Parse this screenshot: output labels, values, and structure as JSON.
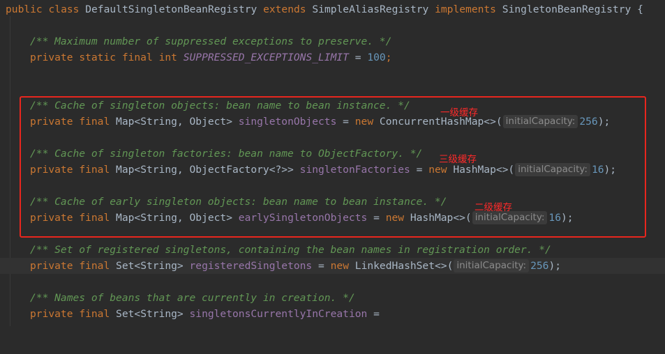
{
  "code": {
    "class_decl": {
      "kw_public": "public",
      "kw_class": "class",
      "class_name": "DefaultSingletonBeanRegistry",
      "kw_extends": "extends",
      "super_name": "SimpleAliasRegistry",
      "kw_implements": "implements",
      "iface_name": "SingletonBeanRegistry",
      "brace": "{"
    },
    "suppressed": {
      "comment": "/** Maximum number of suppressed exceptions to preserve. */",
      "kw_private": "private",
      "kw_static": "static",
      "kw_final": "final",
      "kw_int": "int",
      "const_name": "SUPPRESSED_EXCEPTIONS_LIMIT",
      "assign": "=",
      "value": "100",
      "semi": ";"
    },
    "singleton_objects": {
      "comment": "/** Cache of singleton objects: bean name to bean instance. */",
      "kw_private": "private",
      "kw_final": "final",
      "type": "Map<String, Object>",
      "field": "singletonObjects",
      "assign": "=",
      "kw_new": "new",
      "ctor": "ConcurrentHashMap<>(",
      "hint": "initialCapacity:",
      "arg": "256",
      "close": ");"
    },
    "singleton_factories": {
      "comment": "/** Cache of singleton factories: bean name to ObjectFactory. */",
      "kw_private": "private",
      "kw_final": "final",
      "type": "Map<String, ObjectFactory<?>>",
      "field": "singletonFactories",
      "assign": "=",
      "kw_new": "new",
      "ctor": "HashMap<>(",
      "hint": "initialCapacity:",
      "arg": "16",
      "close": ");"
    },
    "early_singleton_objects": {
      "comment": "/** Cache of early singleton objects: bean name to bean instance. */",
      "kw_private": "private",
      "kw_final": "final",
      "type": "Map<String, Object>",
      "field": "earlySingletonObjects",
      "assign": "=",
      "kw_new": "new",
      "ctor": "HashMap<>(",
      "hint": "initialCapacity:",
      "arg": "16",
      "close": ");"
    },
    "registered_singletons": {
      "comment": "/** Set of registered singletons, containing the bean names in registration order. */",
      "kw_private": "private",
      "kw_final": "final",
      "type": "Set<String>",
      "field": "registeredSingletons",
      "assign": "=",
      "kw_new": "new",
      "ctor": "LinkedHashSet<>(",
      "hint": "initialCapacity:",
      "arg": "256",
      "close": ");"
    },
    "currently_in_creation": {
      "comment": "/** Names of beans that are currently in creation. */",
      "kw_private": "private",
      "kw_final": "final",
      "type": "Set<String>",
      "field": "singletonsCurrentlyInCreation",
      "assign": "="
    }
  },
  "annotations": {
    "first_level": "一级缓存",
    "third_level": "三级缓存",
    "second_level": "二级缓存"
  },
  "colors": {
    "background": "#2b2b2b",
    "keyword": "#cc7832",
    "comment": "#629755",
    "field": "#9876aa",
    "number": "#6897bb",
    "annotation_red": "#e8261e"
  }
}
